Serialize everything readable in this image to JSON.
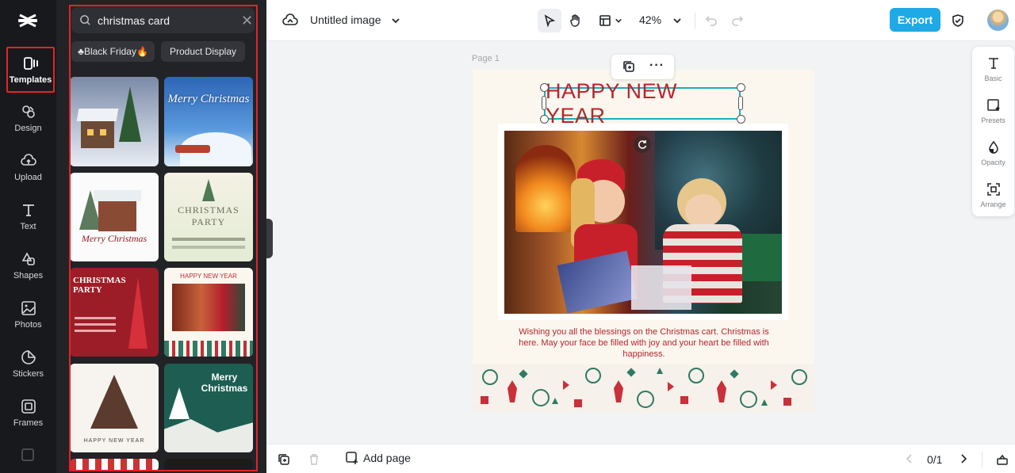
{
  "app": {
    "logo": "capcut-logo"
  },
  "rail": {
    "items": [
      {
        "label": "Templates",
        "icon": "templates-icon"
      },
      {
        "label": "Design",
        "icon": "design-icon"
      },
      {
        "label": "Upload",
        "icon": "upload-icon"
      },
      {
        "label": "Text",
        "icon": "text-icon"
      },
      {
        "label": "Shapes",
        "icon": "shapes-icon"
      },
      {
        "label": "Photos",
        "icon": "photos-icon"
      },
      {
        "label": "Stickers",
        "icon": "stickers-icon"
      },
      {
        "label": "Frames",
        "icon": "frames-icon"
      }
    ]
  },
  "panel": {
    "search_value": "christmas card",
    "chips": [
      "♣Black Friday🔥",
      "Product Display"
    ],
    "thumbs": [
      {
        "title": ""
      },
      {
        "title": "Merry Christmas"
      },
      {
        "title": "Merry Christmas"
      },
      {
        "title": "CHRISTMAS PARTY"
      },
      {
        "title": "CHRISTMAS PARTY"
      },
      {
        "title": "HAPPY NEW YEAR"
      },
      {
        "title": "HAPPY NEW YEAR"
      },
      {
        "title": "Merry Christmas"
      }
    ]
  },
  "topbar": {
    "title": "Untitled image",
    "zoom": "42%",
    "export_label": "Export"
  },
  "canvas": {
    "page_label": "Page 1",
    "heading": "HAPPY NEW YEAR",
    "message": "Wishing you all the blessings on the Christmas cart. Christmas is here. May your face be filled with joy and your heart be filled with happiness."
  },
  "right_panel": {
    "items": [
      "Basic",
      "Presets",
      "Opacity",
      "Arrange"
    ]
  },
  "bottombar": {
    "add_page": "Add page",
    "pager": "0/1"
  },
  "colors": {
    "accent": "#1fa9e6",
    "highlight": "#e0242a",
    "heading": "#b5262f"
  }
}
